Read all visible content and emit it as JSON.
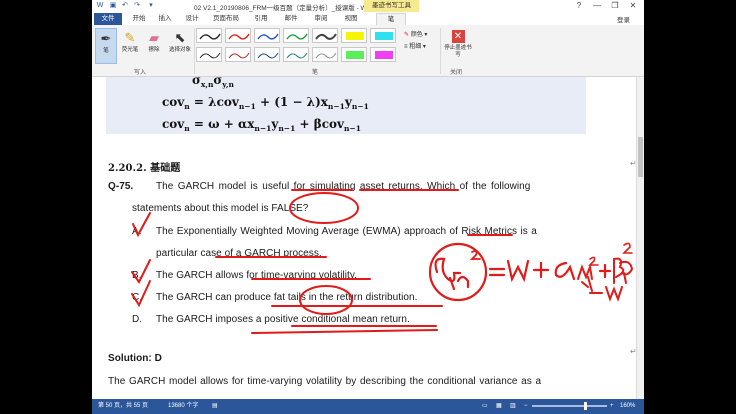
{
  "titlebar": {
    "doc_title": "02 V2.1_20190806_FRM一级百题（定量分析）_授课版 - Word",
    "context_tab": "墨迹书写工具",
    "help": "?",
    "minimize": "—",
    "restore": "❐",
    "close": "✕"
  },
  "tabs": {
    "file": "文件",
    "items": [
      "开始",
      "插入",
      "设计",
      "页面布局",
      "引用",
      "邮件",
      "审阅",
      "视图",
      "笔"
    ],
    "login": "登录"
  },
  "ribbon": {
    "write_group": "写入",
    "pen_group": "笔",
    "close_group": "关闭",
    "pen_btn": "笔",
    "highlighter_btn": "荧光笔",
    "eraser_btn": "擦除",
    "select_btn": "选择对象",
    "color_label": "颜色",
    "weight_label": "粗细",
    "stop_inking": "停止墨迹书写"
  },
  "document": {
    "f1": "σ",
    "f1_sub": "x,n",
    "f1b": "σ",
    "f1b_sub": "y,n",
    "f2_a": "cov",
    "f2_a_sub": "n",
    "f2_b": " = λcov",
    "f2_b_sub": "n−1",
    "f2_c": " + (1 − λ)x",
    "f2_c_sub": "n−1",
    "f2_d": "y",
    "f2_d_sub": "n−1",
    "f3_a": "cov",
    "f3_a_sub": "n",
    "f3_b": " = ω + αx",
    "f3_b_sub": "n−1",
    "f3_c": "y",
    "f3_c_sub": "n−1",
    "f3_d": " + βcov",
    "f3_d_sub": "n−1",
    "section": "2.20.2.  基础题",
    "qnum": "Q-75.",
    "q_line1": "The GARCH model is useful for simulating asset returns. Which of the following",
    "q_line2": "statements about this model is FALSE?",
    "a_label": "A.",
    "a_line1": "The Exponentially Weighted Moving Average (EWMA) approach of Risk Metrics is a",
    "a_line2": "particular case of a GARCH process.",
    "b_label": "B.",
    "b_text": "The GARCH allows for time-varying volatility.",
    "c_label": "C.",
    "c_text": "The GARCH can produce fat tails in the return distribution.",
    "d_label": "D.",
    "d_text": "The GARCH imposes a positive conditional mean return.",
    "solution": "Solution: D",
    "sol_line1": "The GARCH model allows for time-varying volatility by describing the conditional variance as a"
  },
  "status": {
    "page": "第 50 页，共 55 页",
    "words": "13680 个字",
    "zoom": "160%"
  },
  "colors": {
    "word_blue": "#2b579a",
    "ink_red": "#e11a1a",
    "formula_bg": "#e8ecf6",
    "context_yellow": "#f7e98e"
  }
}
